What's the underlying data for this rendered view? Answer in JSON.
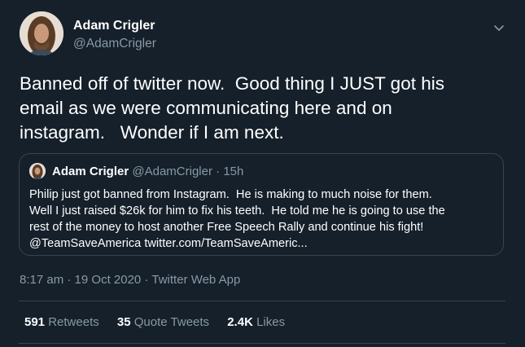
{
  "tweet": {
    "author": {
      "name": "Adam Crigler",
      "handle": "@AdamCrigler"
    },
    "text": "Banned off of twitter now.  Good thing I JUST got his\nemail as we were communicating here and on\ninstagram.   Wonder if I am next.",
    "quoted": {
      "name": "Adam Crigler",
      "handle": "@AdamCrigler",
      "separator": "·",
      "time": "15h",
      "text": "Philip just got banned from Instagram.  He is making to much noise for them.\nWell I just raised $26k for him to fix his teeth.  He told me he is going to use the\nrest of the money to host another Free Speech Rally and continue his fight!\n@TeamSaveAmerica twitter.com/TeamSaveAmeric..."
    },
    "timestamp": {
      "time": "8:17 am",
      "sep1": "·",
      "date": "19 Oct 2020",
      "sep2": "·",
      "source": "Twitter Web App"
    },
    "stats": {
      "retweets_count": "591",
      "retweets_label": "Retweets",
      "quotes_count": "35",
      "quotes_label": "Quote Tweets",
      "likes_count": "2.4K",
      "likes_label": "Likes"
    }
  },
  "icons": {
    "caret": "chevron-down-icon",
    "avatar": "profile-photo"
  },
  "colors": {
    "background": "#15202b",
    "secondary_text": "#8899a6",
    "border": "#38444d",
    "primary_text": "#ffffff"
  }
}
